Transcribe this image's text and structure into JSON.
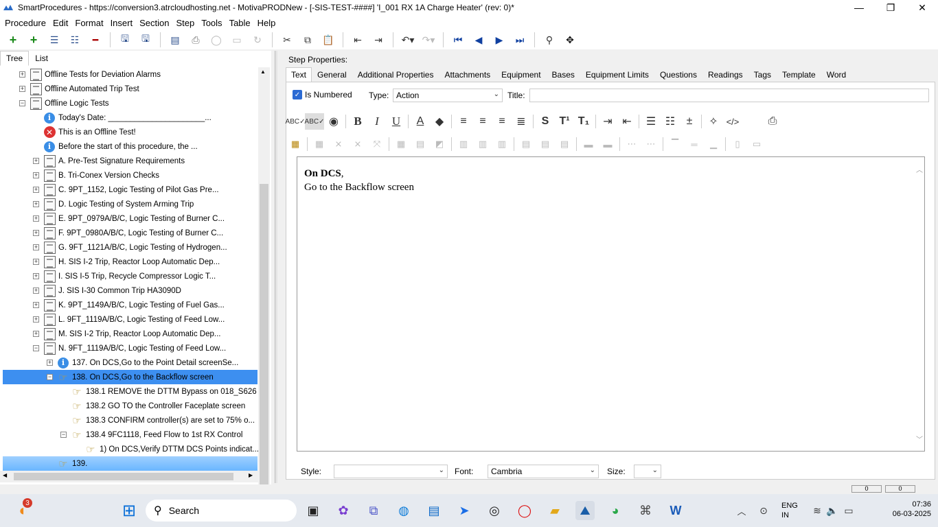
{
  "window": {
    "title": "SmartProcedures - https://conversion3.atrcloudhosting.net - MotivaPRODNew - [-SIS-TEST-####] 'I_001 RX 1A Charge Heater' (rev: 0)*",
    "minimize": "—",
    "maximize": "❐",
    "close": "✕"
  },
  "menu": [
    "Procedure",
    "Edit",
    "Format",
    "Insert",
    "Section",
    "Step",
    "Tools",
    "Table",
    "Help"
  ],
  "left_tabs": [
    "Tree",
    "List"
  ],
  "tree": [
    {
      "label": "Offline Tests for Deviation Alarms",
      "exp": "+",
      "icon": "doc",
      "indent": 0
    },
    {
      "label": "Offline Automated Trip Test",
      "exp": "+",
      "icon": "doc",
      "indent": 0
    },
    {
      "label": "Offline Logic Tests",
      "exp": "−",
      "icon": "doc",
      "indent": 0
    },
    {
      "label": "Today's Date: ______________________...",
      "exp": "",
      "icon": "info",
      "indent": 1
    },
    {
      "label": "This is an Offline Test!",
      "exp": "",
      "icon": "error",
      "indent": 1
    },
    {
      "label": "Before the start of this procedure, the ...",
      "exp": "",
      "icon": "info",
      "indent": 1
    },
    {
      "label": "A. Pre-Test Signature Requirements",
      "exp": "+",
      "icon": "doc",
      "indent": 1
    },
    {
      "label": "B. Tri-Conex Version Checks",
      "exp": "+",
      "icon": "doc",
      "indent": 1
    },
    {
      "label": "C. 9PT_1152, Logic Testing of Pilot Gas Pre...",
      "exp": "+",
      "icon": "doc",
      "indent": 1
    },
    {
      "label": "D. Logic Testing of System Arming Trip",
      "exp": "+",
      "icon": "doc",
      "indent": 1
    },
    {
      "label": "E. 9PT_0979A/B/C, Logic Testing of Burner C...",
      "exp": "+",
      "icon": "doc",
      "indent": 1
    },
    {
      "label": "F. 9PT_0980A/B/C, Logic Testing of Burner C...",
      "exp": "+",
      "icon": "doc",
      "indent": 1
    },
    {
      "label": "G. 9FT_1121A/B/C, Logic Testing of Hydrogen...",
      "exp": "+",
      "icon": "doc",
      "indent": 1
    },
    {
      "label": "H. SIS I-2 Trip, Reactor Loop Automatic Dep...",
      "exp": "+",
      "icon": "doc",
      "indent": 1
    },
    {
      "label": "I. SIS I-5 Trip, Recycle Compressor Logic T...",
      "exp": "+",
      "icon": "doc",
      "indent": 1
    },
    {
      "label": "J. SIS I-30 Common Trip HA3090D",
      "exp": "+",
      "icon": "doc",
      "indent": 1
    },
    {
      "label": "K. 9PT_1149A/B/C, Logic Testing of Fuel Gas...",
      "exp": "+",
      "icon": "doc",
      "indent": 1
    },
    {
      "label": "L. 9FT_1119A/B/C, Logic Testing of Feed Low...",
      "exp": "+",
      "icon": "doc",
      "indent": 1
    },
    {
      "label": "M. SIS I-2 Trip, Reactor Loop Automatic Dep...",
      "exp": "+",
      "icon": "doc",
      "indent": 1
    },
    {
      "label": "N. 9FT_1119A/B/C, Logic Testing of Feed Low...",
      "exp": "−",
      "icon": "doc",
      "indent": 1
    },
    {
      "label": "137. On DCS,Go to the Point Detail screenSe...",
      "exp": "+",
      "icon": "info",
      "indent": 2
    },
    {
      "label": "138. On DCS,Go to the Backflow screen",
      "exp": "−",
      "icon": "hand",
      "indent": 2,
      "selected": "primary"
    },
    {
      "label": "138.1 REMOVE the DTTM Bypass on 018_S626",
      "exp": "",
      "icon": "hand",
      "indent": 3
    },
    {
      "label": "138.2 GO TO the Controller Faceplate screen",
      "exp": "",
      "icon": "hand",
      "indent": 3
    },
    {
      "label": "138.3 CONFIRM controller(s) are set to 75% o...",
      "exp": "",
      "icon": "hand",
      "indent": 3
    },
    {
      "label": "138.4 9FC1118, Feed Flow to 1st RX Control",
      "exp": "−",
      "icon": "hand",
      "indent": 3
    },
    {
      "label": "1) On DCS,Verify DTTM DCS Points indicat...",
      "exp": "",
      "icon": "hand",
      "indent": 4
    },
    {
      "label": "139.",
      "exp": "",
      "icon": "hand",
      "indent": 2,
      "selected": "secondary"
    }
  ],
  "step_properties": {
    "label": "Step Properties:",
    "tabs": [
      "Text",
      "General",
      "Additional Properties",
      "Attachments",
      "Equipment",
      "Bases",
      "Equipment Limits",
      "Questions",
      "Readings",
      "Tags",
      "Template",
      "Word"
    ],
    "is_numbered_label": "Is Numbered",
    "type_label": "Type:",
    "type_value": "Action",
    "title_label": "Title:",
    "title_value": ""
  },
  "editor": {
    "line1": "On DCS",
    "line1_suffix": ",",
    "line2": "Go to the Backflow screen"
  },
  "bottom": {
    "style_label": "Style:",
    "style_value": "",
    "font_label": "Font:",
    "font_value": "Cambria",
    "size_label": "Size:",
    "size_value": ""
  },
  "status": {
    "box1": "0",
    "box2": "0"
  },
  "taskbar": {
    "search_label": "Search",
    "badge": "3",
    "lang": "ENG",
    "region": "IN",
    "time": "07:36",
    "date": "06-03-2025"
  }
}
